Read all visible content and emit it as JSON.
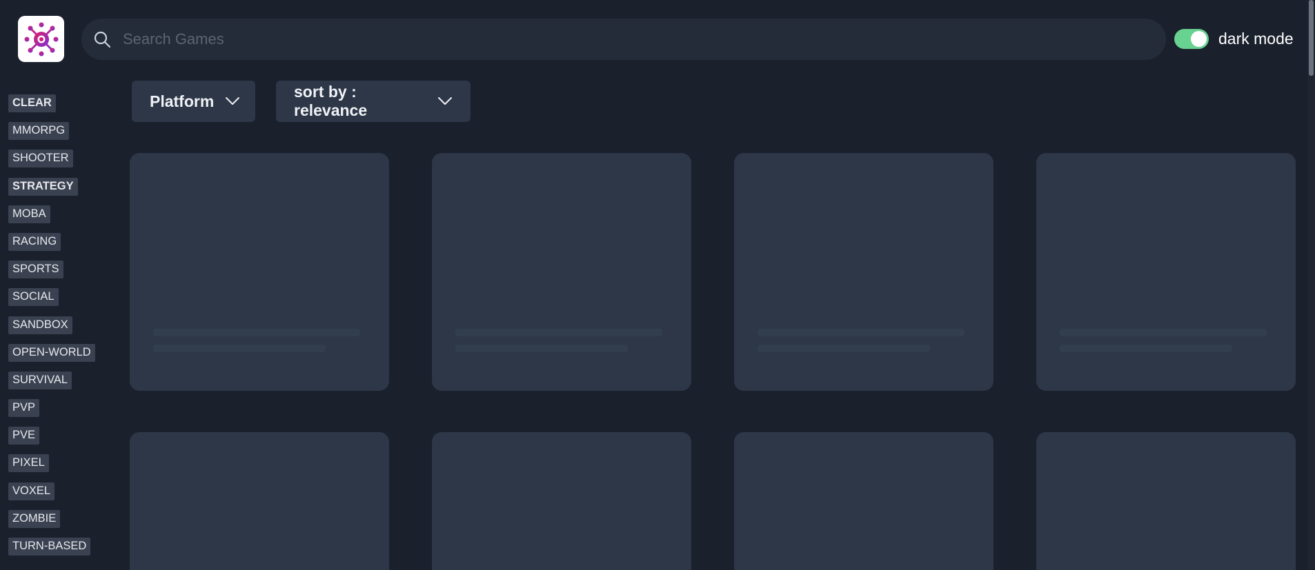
{
  "header": {
    "logo_icon": "virus-icon",
    "search": {
      "placeholder": "Search Games",
      "value": ""
    },
    "dark_mode": {
      "label": "dark mode",
      "enabled": true
    }
  },
  "sidebar": {
    "categories": [
      {
        "label": "CLEAR",
        "bold": true
      },
      {
        "label": "MMORPG",
        "bold": false
      },
      {
        "label": "SHOOTER",
        "bold": false
      },
      {
        "label": "STRATEGY",
        "bold": true
      },
      {
        "label": "MOBA",
        "bold": false
      },
      {
        "label": "RACING",
        "bold": false
      },
      {
        "label": "SPORTS",
        "bold": false
      },
      {
        "label": "SOCIAL",
        "bold": false
      },
      {
        "label": "SANDBOX",
        "bold": false
      },
      {
        "label": "OPEN-WORLD",
        "bold": false
      },
      {
        "label": "SURVIVAL",
        "bold": false
      },
      {
        "label": "PVP",
        "bold": false
      },
      {
        "label": "PVE",
        "bold": false
      },
      {
        "label": "PIXEL",
        "bold": false
      },
      {
        "label": "VOXEL",
        "bold": false
      },
      {
        "label": "ZOMBIE",
        "bold": false
      },
      {
        "label": "TURN-BASED",
        "bold": false
      }
    ]
  },
  "filters": {
    "platform_label": "Platform",
    "sort_label": "sort by : relevance"
  },
  "colors": {
    "background": "#1a202c",
    "surface": "#2d3748",
    "toggle_on": "#68d391",
    "logo_magenta": "#d6177f",
    "logo_purple": "#7b2fd6"
  }
}
